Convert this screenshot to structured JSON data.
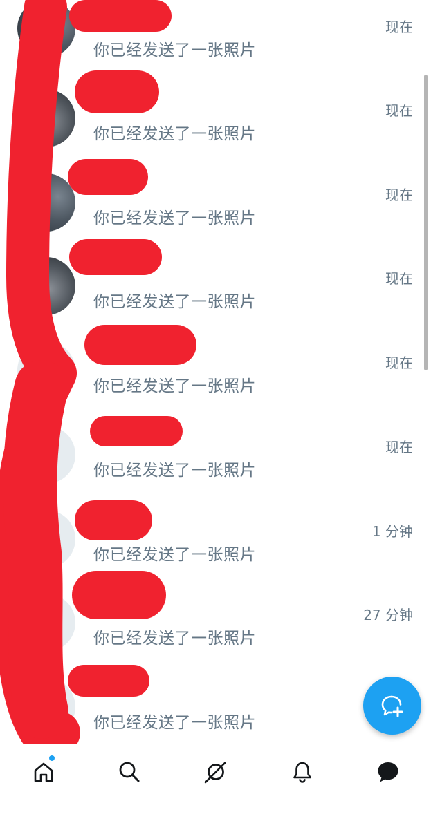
{
  "conversations": [
    {
      "preview": "你已经发送了一张照片",
      "time": "现在"
    },
    {
      "preview": "你已经发送了一张照片",
      "time": "现在"
    },
    {
      "preview": "你已经发送了一张照片",
      "time": "现在"
    },
    {
      "preview": "你已经发送了一张照片",
      "time": "现在"
    },
    {
      "preview": "你已经发送了一张照片",
      "time": "现在"
    },
    {
      "preview": "你已经发送了一张照片",
      "time": "现在"
    },
    {
      "preview": "你已经发送了一张照片",
      "time": "1 分钟"
    },
    {
      "preview": "你已经发送了一张照片",
      "time": "27 分钟"
    },
    {
      "preview": "你已经发送了一张照片",
      "time": ""
    }
  ],
  "tabs": [
    {
      "icon": "home-icon",
      "has_notification": true
    },
    {
      "icon": "search-icon"
    },
    {
      "icon": "spaces-icon"
    },
    {
      "icon": "bell-icon"
    },
    {
      "icon": "messages-icon"
    }
  ],
  "fab_icon": "new-message-icon",
  "colors": {
    "accent": "#1da1f2",
    "secondary_text": "#657786",
    "redaction": "#f0222f"
  }
}
